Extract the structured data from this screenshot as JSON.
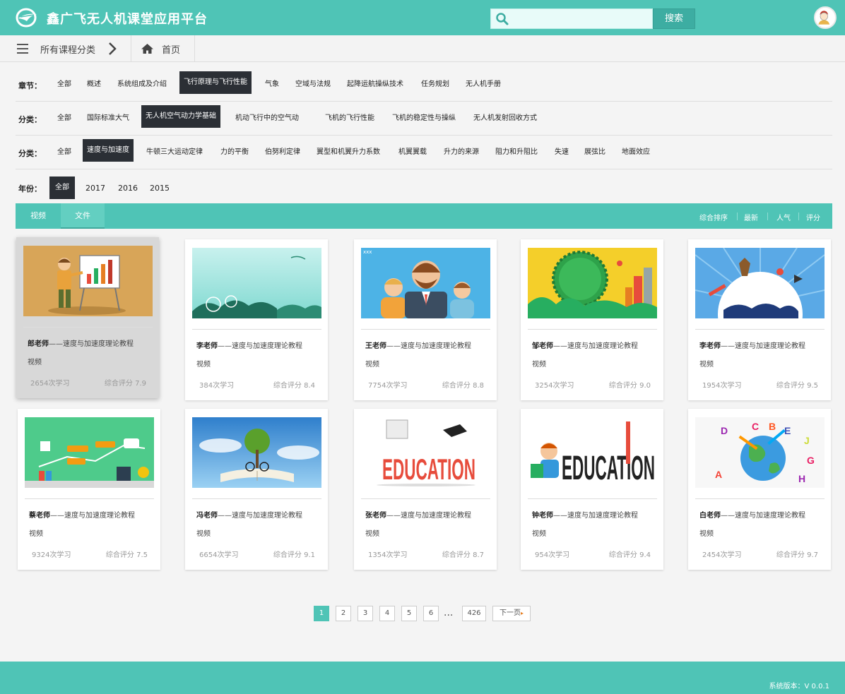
{
  "header": {
    "app_title": "鑫广飞无人机课堂应用平台",
    "search_placeholder": "",
    "search_button": "搜索"
  },
  "breadcrumb": {
    "category": "所有课程分类",
    "home": "首页"
  },
  "filters": {
    "chapter": {
      "label": "章节：",
      "items": [
        "全部",
        "概述",
        "系统组成及介绍",
        "飞行原理与飞行性能",
        "气象",
        "空域与法规",
        "起降运航操纵技术",
        "任务规划",
        "无人机手册"
      ],
      "active": 3
    },
    "category1": {
      "label": "分类：",
      "items": [
        "全部",
        "国际标准大气",
        "无人机空气动力学基础",
        "机动飞行中的空气动",
        "飞机的飞行性能",
        "飞机的稳定性与操纵",
        "无人机发射回收方式"
      ],
      "active": 2
    },
    "category2": {
      "label": "分类：",
      "items": [
        "全部",
        "速度与加速度",
        "牛顿三大运动定律",
        "力的平衡",
        "伯努利定律",
        "翼型和机翼升力系数",
        "机翼翼载",
        "升力的来源",
        "阻力和升阻比",
        "失速",
        "展弦比",
        "地面效应"
      ],
      "active": 1
    },
    "year": {
      "label": "年份：",
      "items": [
        "全部",
        "2017",
        "2016",
        "2015"
      ],
      "active": 0
    }
  },
  "tabs": {
    "items": [
      "视频",
      "文件"
    ],
    "active": 1
  },
  "sort_options": [
    "综合排序",
    "最新",
    "人气",
    "评分"
  ],
  "courses": [
    {
      "teacher": "郎老师",
      "title": "——速度与加速度理论教程",
      "type": "视频",
      "count": "2654次学习",
      "score": "综合评分 7.9"
    },
    {
      "teacher": "李老师",
      "title": "——速度与加速度理论教程",
      "type": "视频",
      "count": "384次学习",
      "score": "综合评分 8.4"
    },
    {
      "teacher": "王老师",
      "title": "——速度与加速度理论教程",
      "type": "视频",
      "count": "7754次学习",
      "score": "综合评分 8.8"
    },
    {
      "teacher": "邹老师",
      "title": "——速度与加速度理论教程",
      "type": "视频",
      "count": "3254次学习",
      "score": "综合评分 9.0"
    },
    {
      "teacher": "李老师",
      "title": "——速度与加速度理论教程",
      "type": "视频",
      "count": "1954次学习",
      "score": "综合评分 9.5"
    },
    {
      "teacher": "蔡老师",
      "title": "——速度与加速度理论教程",
      "type": "视频",
      "count": "9324次学习",
      "score": "综合评分 7.5"
    },
    {
      "teacher": "冯老师",
      "title": "——速度与加速度理论教程",
      "type": "视频",
      "count": "6654次学习",
      "score": "综合评分 9.1"
    },
    {
      "teacher": "张老师",
      "title": "——速度与加速度理论教程",
      "type": "视频",
      "count": "1354次学习",
      "score": "综合评分 8.7"
    },
    {
      "teacher": "钟老师",
      "title": "——速度与加速度理论教程",
      "type": "视频",
      "count": "954次学习",
      "score": "综合评分 9.4"
    },
    {
      "teacher": "白老师",
      "title": "——速度与加速度理论教程",
      "type": "视频",
      "count": "2454次学习",
      "score": "综合评分 9.7"
    }
  ],
  "thumb_texts": {
    "t3": "xxx",
    "t8": "EDUCATION",
    "t9": "EDUCATION",
    "t10": [
      "D",
      "C",
      "B",
      "E",
      "J",
      "G",
      "H",
      "A"
    ]
  },
  "pagination": {
    "pages": [
      "1",
      "2",
      "3",
      "4",
      "5",
      "6"
    ],
    "active": 0,
    "dots": "...",
    "last": "426",
    "next": "下一页"
  },
  "footer": {
    "version": "系统版本：V 0.0.1"
  },
  "colors": {
    "primary": "#4fc4b6",
    "dark": "#2b2f35",
    "active_page": "#4fc4b6"
  }
}
